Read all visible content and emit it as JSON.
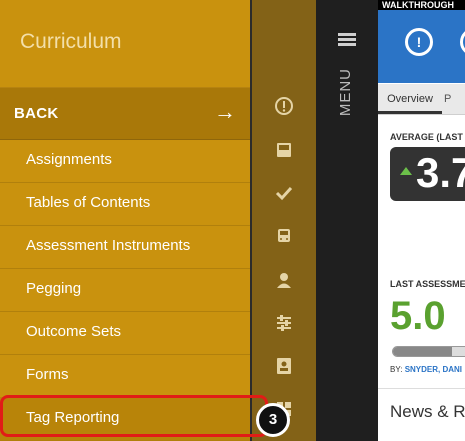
{
  "curriculum_panel": {
    "title": "Curriculum",
    "back_label": "BACK",
    "back_arrow": "→",
    "items": [
      {
        "label": "Assignments"
      },
      {
        "label": "Tables of Contents"
      },
      {
        "label": "Assessment Instruments"
      },
      {
        "label": "Pegging"
      },
      {
        "label": "Outcome Sets"
      },
      {
        "label": "Forms"
      },
      {
        "label": "Tag Reporting"
      }
    ],
    "step_badge": "3"
  },
  "icon_strip": {
    "icons": [
      "info-circle-icon",
      "inbox-icon",
      "checkmark-icon",
      "bus-icon",
      "person-icon",
      "sliders-icon",
      "contact-card-icon",
      "grid-icon"
    ]
  },
  "menu_column": {
    "label": "MENU"
  },
  "preview": {
    "walkthrough_label": "WALKTHROUGH",
    "tabs": {
      "overview": "Overview",
      "next": "P"
    },
    "average_label": "AVERAGE (LAST",
    "average_value": "3.7",
    "last_assessment_label": "LAST ASSESSME",
    "last_assessment_value": "5.0",
    "by_prefix": "BY:",
    "by_name": "SNYDER, DANI",
    "news_title": "News & R",
    "progress_fraction": 0.6
  },
  "colors": {
    "panel_gold": "#c9920e",
    "highlight_red": "#e11c17",
    "brand_blue": "#2b74c6",
    "score_green": "#5aa12f"
  }
}
